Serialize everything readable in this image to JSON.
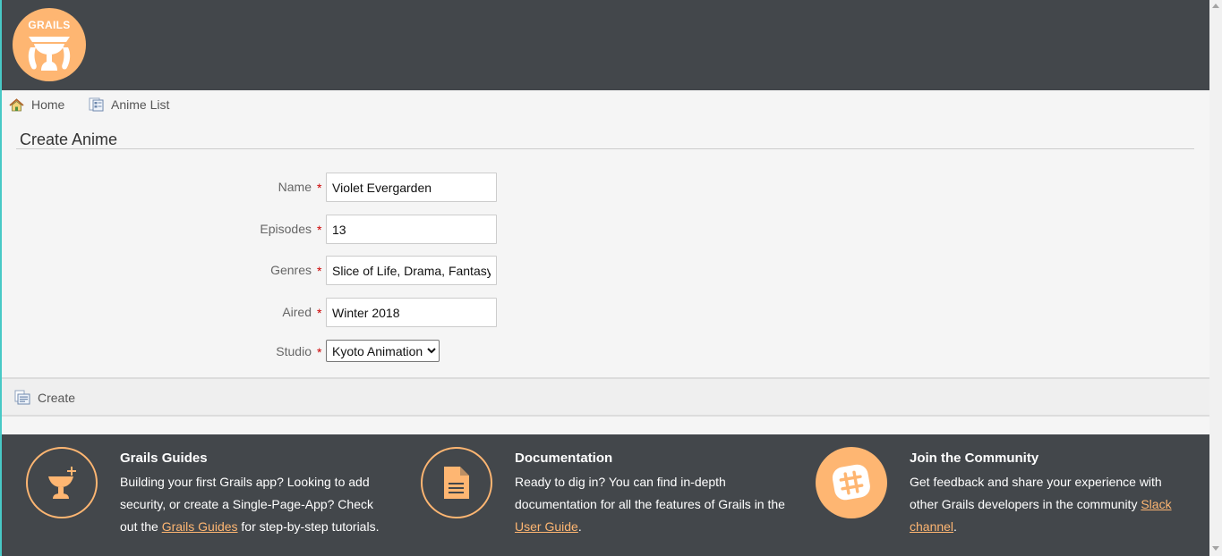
{
  "header": {
    "logo_text": "GRAILS",
    "logo_icon": "grails-cup-icon",
    "background_color": "#43474b",
    "accent_color": "#feb672"
  },
  "nav": {
    "items": [
      {
        "label": "Home",
        "icon": "home-icon"
      },
      {
        "label": "Anime List",
        "icon": "list-icon"
      }
    ]
  },
  "page": {
    "title": "Create Anime"
  },
  "form": {
    "fields": [
      {
        "label": "Name",
        "required_marker": "*",
        "value": "Violet Evergarden"
      },
      {
        "label": "Episodes",
        "required_marker": "*",
        "value": "13"
      },
      {
        "label": "Genres",
        "required_marker": "*",
        "value": "Slice of Life, Drama, Fantasy"
      },
      {
        "label": "Aired",
        "required_marker": "*",
        "value": "Winter 2018"
      }
    ],
    "studio": {
      "label": "Studio",
      "required_marker": "*",
      "selected": "Kyoto Animation"
    },
    "create_label": "Create",
    "create_icon": "create-icon"
  },
  "footer": {
    "columns": [
      {
        "icon": "grails-guides-icon",
        "title": "Grails Guides",
        "text_before": "Building your first Grails app? Looking to add security, or create a Single-Page-App? Check out the ",
        "link": "Grails Guides",
        "text_after": " for step-by-step tutorials."
      },
      {
        "icon": "document-icon",
        "title": "Documentation",
        "text_before": "Ready to dig in? You can find in-depth documentation for all the features of Grails in the ",
        "link": "User Guide",
        "text_after": "."
      },
      {
        "icon": "slack-icon",
        "title": "Join the Community",
        "text_before": "Get feedback and share your experience with other Grails developers in the community ",
        "link": "Slack channel",
        "text_after": "."
      }
    ]
  },
  "colors": {
    "required": "#cc0000",
    "left_border": "#48c9c6",
    "footer_bg": "#43474b"
  }
}
